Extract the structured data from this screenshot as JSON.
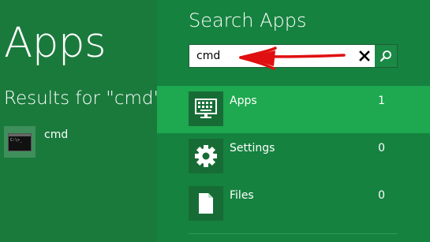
{
  "left_panel": {
    "title": "Apps",
    "results_heading": "Results for \"cmd\"",
    "results": [
      {
        "label": "cmd",
        "icon": "command-prompt-icon"
      }
    ]
  },
  "search_pane": {
    "title": "Search Apps",
    "query": "cmd",
    "clear_icon": "close-icon",
    "search_icon": "magnifier-icon",
    "categories": [
      {
        "label": "Apps",
        "count": "1",
        "icon": "keyboard-monitor-icon",
        "selected": true
      },
      {
        "label": "Settings",
        "count": "0",
        "icon": "gear-icon",
        "selected": false
      },
      {
        "label": "Files",
        "count": "0",
        "icon": "document-icon",
        "selected": false
      }
    ]
  },
  "colors": {
    "left_background": "#1a7a3c",
    "pane_background": "#15823f",
    "selected_category": "#1ea84f",
    "annotation_arrow": "#e01010"
  }
}
